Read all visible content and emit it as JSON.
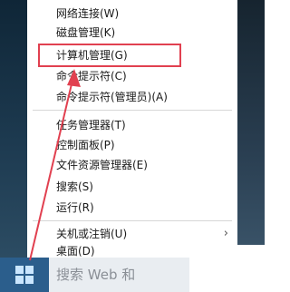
{
  "menu": {
    "items": [
      {
        "label": "网络连接(W)"
      },
      {
        "label": "磁盘管理(K)"
      },
      {
        "label": "计算机管理(G)"
      },
      {
        "label": "命令提示符(C)"
      },
      {
        "label": "命令提示符(管理员)(A)"
      },
      {
        "label": "任务管理器(T)"
      },
      {
        "label": "控制面板(P)"
      },
      {
        "label": "文件资源管理器(E)"
      },
      {
        "label": "搜索(S)"
      },
      {
        "label": "运行(R)"
      },
      {
        "label": "关机或注销(U)"
      },
      {
        "label": "桌面(D)"
      }
    ],
    "submenu_arrow": "›"
  },
  "taskbar": {
    "search_text": "搜索 Web 和"
  },
  "colors": {
    "highlight": "#e14050",
    "start_button": "#2b5e8c"
  },
  "icons": {
    "start": "windows-start-icon",
    "arrow": "annotation-arrow-icon"
  }
}
